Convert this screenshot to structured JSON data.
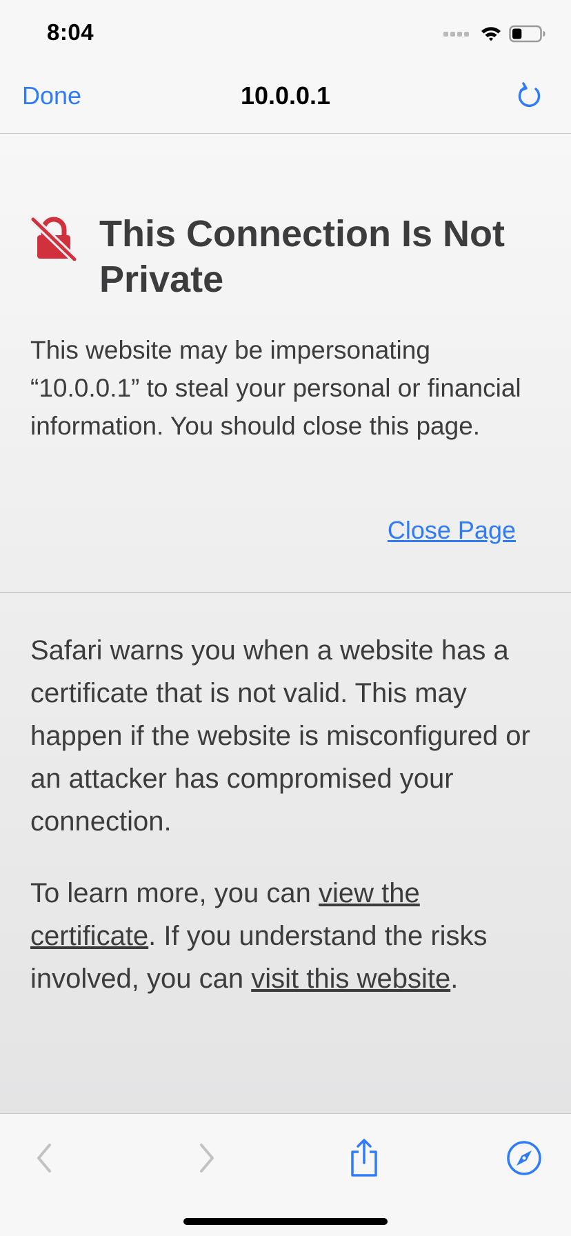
{
  "status_bar": {
    "time": "8:04",
    "battery_level": 0.35
  },
  "nav": {
    "done_label": "Done",
    "title": "10.0.0.1"
  },
  "warning": {
    "title": "This Connection Is Not Private",
    "body": "This website may be impersonating “10.0.0.1” to steal your personal or financial information. You should close this page.",
    "close_label": "Close Page"
  },
  "info": {
    "paragraph1": "Safari warns you when a website has a certificate that is not valid. This may happen if the website is misconfigured or an attacker has compromised your connection.",
    "p2_prefix": "To learn more, you can ",
    "p2_link1": "view the certificate",
    "p2_middle": ". If you understand the risks involved, you can ",
    "p2_link2": "visit this website",
    "p2_suffix": "."
  },
  "colors": {
    "accent": "#2f7cf6",
    "warning_icon": "#d1313d",
    "text": "#3c3c3e",
    "disabled": "#c2c2c5"
  },
  "icons": {
    "lock": "lock-slash-icon",
    "reload": "reload-icon",
    "back": "chevron-left-icon",
    "forward": "chevron-right-icon",
    "share": "share-icon",
    "compass": "compass-icon"
  }
}
